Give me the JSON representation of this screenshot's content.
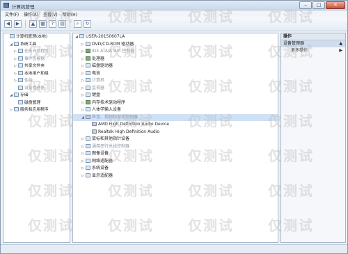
{
  "window": {
    "title": "计算机管理"
  },
  "menu": [
    "文件(F)",
    "操作(A)",
    "查看(V)",
    "帮助(H)"
  ],
  "toolbar": {
    "icons": [
      "back-icon",
      "forward-icon",
      "up-icon",
      "properties-icon",
      "help-icon",
      "view-icon",
      "scan-icon",
      "update-icon"
    ]
  },
  "left_tree": [
    {
      "label": "计算机管理(本地)",
      "depth": 0,
      "exp": "",
      "muted": false
    },
    {
      "label": "系统工具",
      "depth": 1,
      "exp": "◢",
      "muted": false
    },
    {
      "label": "任务计划程序",
      "depth": 2,
      "exp": "▷",
      "muted": true
    },
    {
      "label": "事件查看器",
      "depth": 2,
      "exp": "▷",
      "muted": true
    },
    {
      "label": "共享文件夹",
      "depth": 2,
      "exp": "▷",
      "muted": false
    },
    {
      "label": "本地用户和组",
      "depth": 2,
      "exp": "▷",
      "muted": false
    },
    {
      "label": "性能",
      "depth": 2,
      "exp": "▷",
      "muted": true
    },
    {
      "label": "设备管理器",
      "depth": 2,
      "exp": "",
      "muted": true
    },
    {
      "label": "存储",
      "depth": 1,
      "exp": "◢",
      "muted": false
    },
    {
      "label": "磁盘管理",
      "depth": 2,
      "exp": "",
      "muted": false
    },
    {
      "label": "服务和应用程序",
      "depth": 1,
      "exp": "▷",
      "muted": false
    }
  ],
  "device_tree": [
    {
      "label": "USER-20150607LA",
      "depth": 0,
      "exp": "◢",
      "muted": false,
      "icon": "computer"
    },
    {
      "label": "DVD/CD-ROM 驱动器",
      "depth": 1,
      "exp": "▷",
      "muted": false,
      "icon": "disc"
    },
    {
      "label": "IDE ATA/ATAPI 控制器",
      "depth": 1,
      "exp": "▷",
      "muted": true,
      "icon": "chip"
    },
    {
      "label": "处理器",
      "depth": 1,
      "exp": "▷",
      "muted": false,
      "icon": "chip"
    },
    {
      "label": "磁盘驱动器",
      "depth": 1,
      "exp": "▷",
      "muted": false,
      "icon": "disk"
    },
    {
      "label": "电池",
      "depth": 1,
      "exp": "▷",
      "muted": false,
      "icon": "battery"
    },
    {
      "label": "计算机",
      "depth": 1,
      "exp": "▷",
      "muted": true,
      "icon": "computer"
    },
    {
      "label": "监视器",
      "depth": 1,
      "exp": "▷",
      "muted": true,
      "icon": "monitor"
    },
    {
      "label": "键盘",
      "depth": 1,
      "exp": "▷",
      "muted": false,
      "icon": "keyboard"
    },
    {
      "label": "内存技术驱动程序",
      "depth": 1,
      "exp": "▷",
      "muted": false,
      "icon": "chip"
    },
    {
      "label": "人体学输入设备",
      "depth": 1,
      "exp": "▷",
      "muted": false,
      "icon": "hid"
    },
    {
      "label": "声音、视频和游戏控制器",
      "depth": 1,
      "exp": "◢",
      "muted": true,
      "icon": "sound",
      "selected": true
    },
    {
      "label": "AMD High Definition Audio Device",
      "depth": 2,
      "exp": "",
      "muted": false,
      "icon": "sound"
    },
    {
      "label": "Realtek High Definition Audio",
      "depth": 2,
      "exp": "",
      "muted": false,
      "icon": "sound"
    },
    {
      "label": "鼠标和其他指针设备",
      "depth": 1,
      "exp": "▷",
      "muted": false,
      "icon": "mouse"
    },
    {
      "label": "通用串行总线控制器",
      "depth": 1,
      "exp": "▷",
      "muted": true,
      "icon": "usb"
    },
    {
      "label": "图像设备",
      "depth": 1,
      "exp": "▷",
      "muted": false,
      "icon": "camera"
    },
    {
      "label": "网络适配器",
      "depth": 1,
      "exp": "▷",
      "muted": false,
      "icon": "network"
    },
    {
      "label": "系统设备",
      "depth": 1,
      "exp": "▷",
      "muted": false,
      "icon": "system"
    },
    {
      "label": "显示适配器",
      "depth": 1,
      "exp": "▷",
      "muted": false,
      "icon": "display"
    }
  ],
  "actions": {
    "header": "操作",
    "section": "设备管理器",
    "items": [
      "更多操作"
    ]
  },
  "watermark": "仅测试"
}
